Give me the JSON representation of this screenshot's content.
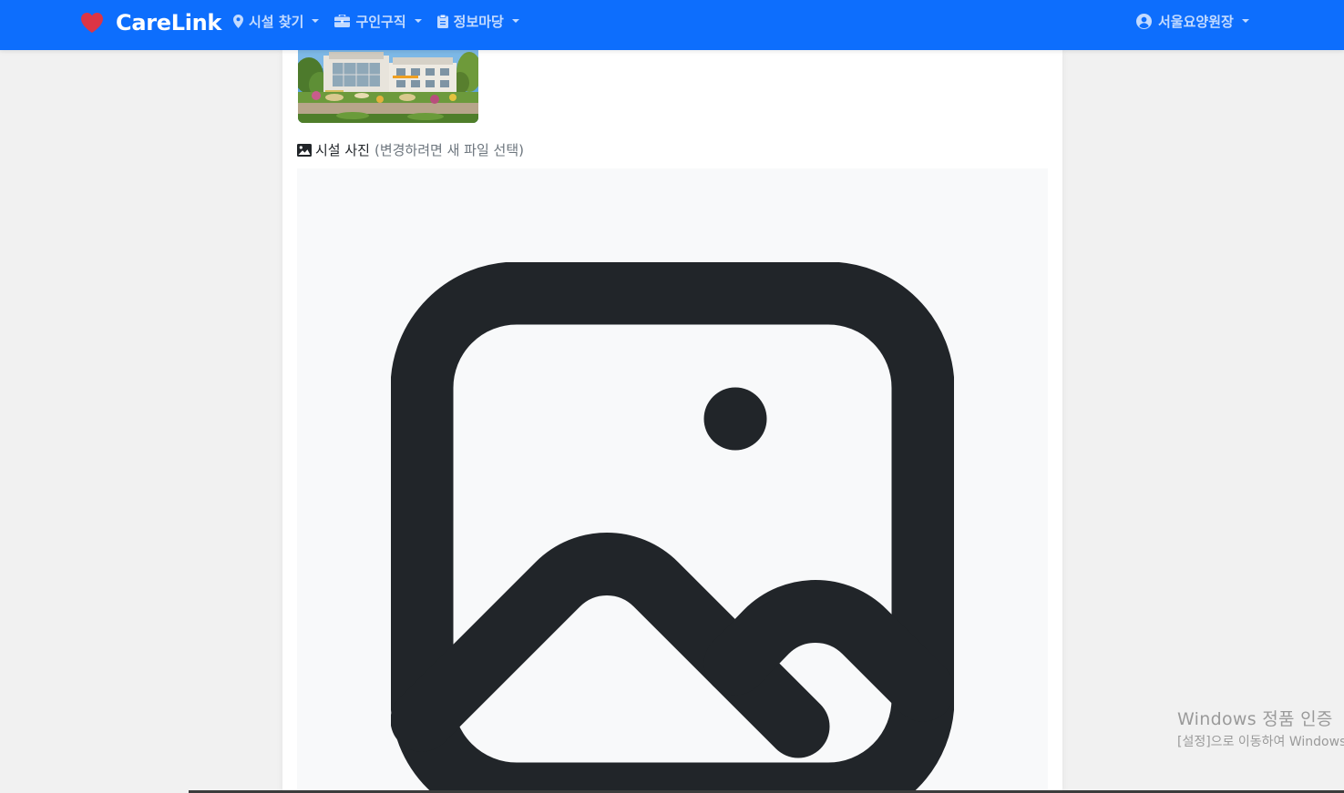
{
  "navbar": {
    "brand": "CareLink",
    "menu": [
      {
        "label": "시설 찾기",
        "icon": "map-marker-icon"
      },
      {
        "label": "구인구직",
        "icon": "briefcase-icon"
      },
      {
        "label": "정보마당",
        "icon": "clipboard-icon"
      }
    ],
    "user": {
      "label": "서울요양원장",
      "icon": "user-circle-icon"
    }
  },
  "form": {
    "photo_label": "시설 사진",
    "photo_hint": "(변경하려면 새 파일 선택)"
  },
  "watermark": {
    "title": "Windows 정품 인증",
    "subtitle": "[설정]으로 이동하여 Windows"
  },
  "colors": {
    "primary": "#0d6efd",
    "heart": "#dc3545",
    "text": "#212529",
    "muted": "#6c757d",
    "upload_bg": "#f8f9fa",
    "page_bg": "#f1f1f1"
  }
}
